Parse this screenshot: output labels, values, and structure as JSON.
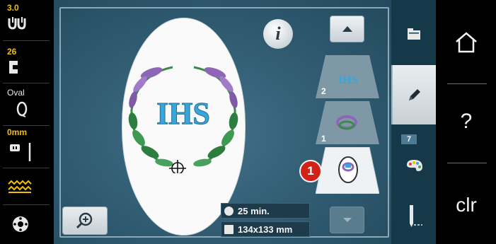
{
  "status_bar": {
    "needle": {
      "value": "3.0",
      "icon": "twin-needle-icon"
    },
    "presser_foot": {
      "value": "26",
      "icon": "presser-foot-icon"
    },
    "hoop": {
      "value": "Oval",
      "icon": "oval-hoop-icon"
    },
    "needle_plate": {
      "value": "0mm",
      "icon": "needle-plate-icon"
    },
    "feed_dog": {
      "icon": "feed-dog-icon"
    },
    "bobbin": {
      "icon": "bobbin-icon"
    }
  },
  "preview": {
    "info_label": "i",
    "design_text": "IHS",
    "time": "25 min.",
    "size": "134x133 mm"
  },
  "layers": [
    {
      "number": "2",
      "icon": "monogram-layer-icon"
    },
    {
      "number": "1",
      "icon": "wreath-layer-icon"
    },
    {
      "number": "",
      "icon": "combined-layer-icon",
      "selected": true
    }
  ],
  "callout_label": "1",
  "tabs": {
    "colors_count": "7"
  },
  "system": {
    "help_label": "?",
    "clear_label": "clr"
  },
  "colors": {
    "accent_yellow": "#f0c000",
    "panel_blue": "#2f5a70",
    "callout_red": "#d1221a"
  }
}
